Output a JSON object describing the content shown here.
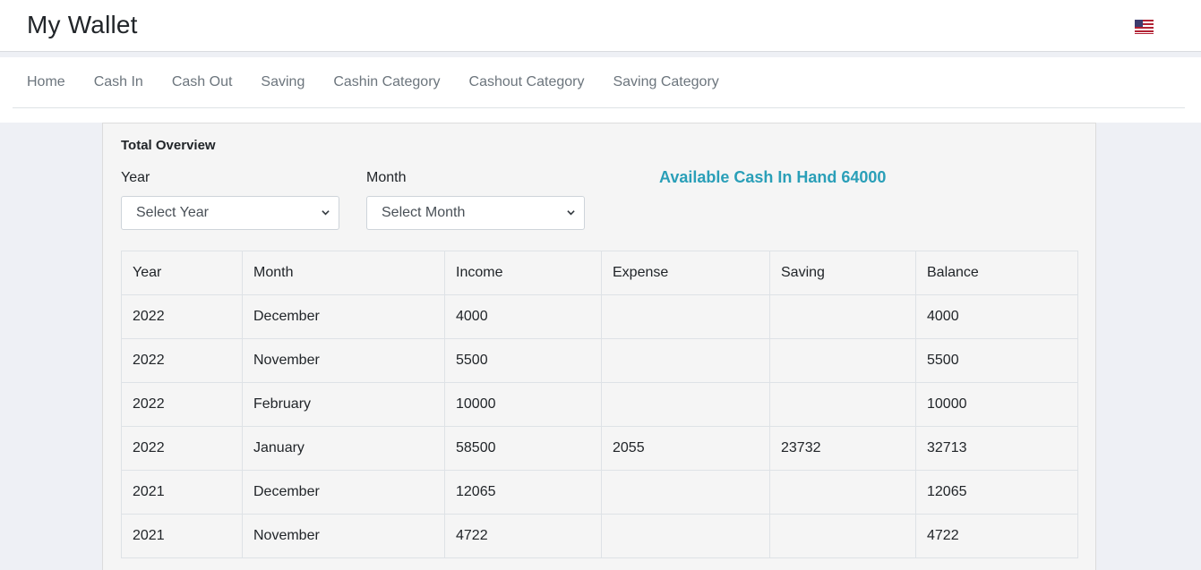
{
  "app": {
    "title": "My Wallet",
    "language_flag": "us-flag-icon"
  },
  "nav": [
    {
      "label": "Home"
    },
    {
      "label": "Cash In"
    },
    {
      "label": "Cash Out"
    },
    {
      "label": "Saving"
    },
    {
      "label": "Cashin Category"
    },
    {
      "label": "Cashout Category"
    },
    {
      "label": "Saving Category"
    }
  ],
  "overview": {
    "title": "Total Overview",
    "year_label": "Year",
    "year_select": "Select Year",
    "month_label": "Month",
    "month_select": "Select Month",
    "cash_in_hand": "Available Cash In Hand 64000",
    "cash_color": "#2a9fb8"
  },
  "table": {
    "headers": [
      "Year",
      "Month",
      "Income",
      "Expense",
      "Saving",
      "Balance"
    ],
    "rows": [
      [
        "2022",
        "December",
        "4000",
        "",
        "",
        "4000"
      ],
      [
        "2022",
        "November",
        "5500",
        "",
        "",
        "5500"
      ],
      [
        "2022",
        "February",
        "10000",
        "",
        "",
        "10000"
      ],
      [
        "2022",
        "January",
        "58500",
        "2055",
        "23732",
        "32713"
      ],
      [
        "2021",
        "December",
        "12065",
        "",
        "",
        "12065"
      ],
      [
        "2021",
        "November",
        "4722",
        "",
        "",
        "4722"
      ]
    ]
  }
}
